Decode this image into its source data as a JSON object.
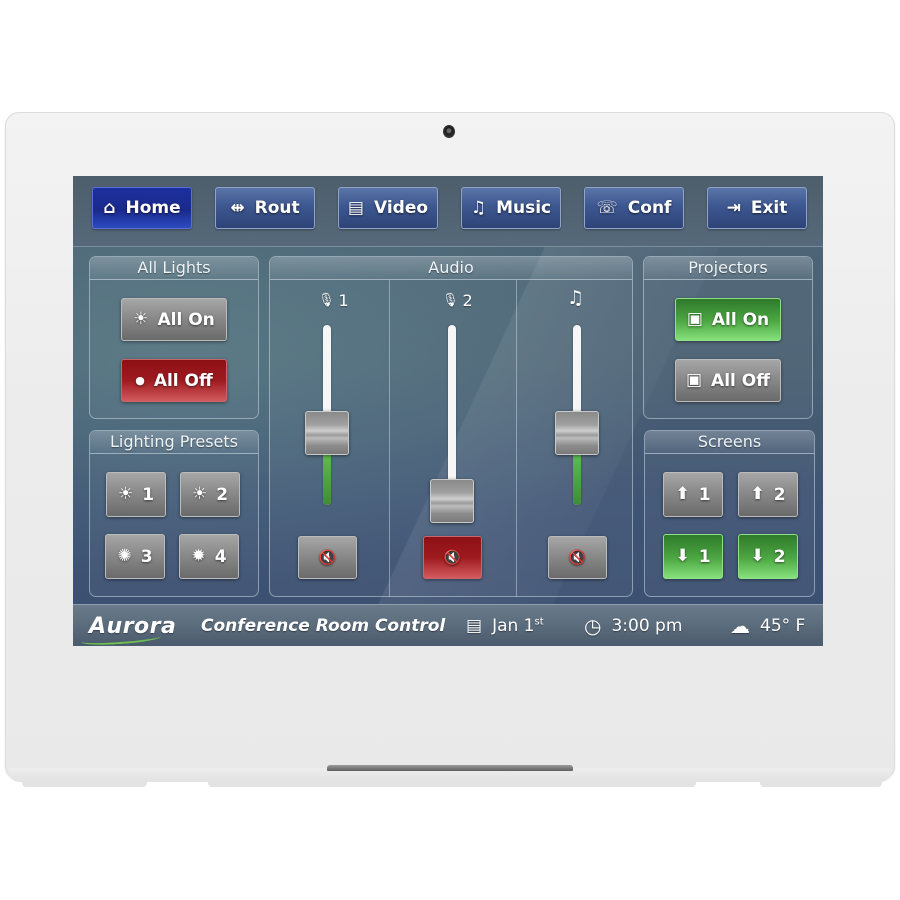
{
  "nav": {
    "items": [
      {
        "label": "Home",
        "icon": "home-icon",
        "glyph": "⌂",
        "active": true
      },
      {
        "label": "Rout",
        "icon": "route-icon",
        "glyph": "⇹",
        "active": false
      },
      {
        "label": "Video",
        "icon": "film-icon",
        "glyph": "▤",
        "active": false
      },
      {
        "label": "Music",
        "icon": "music-note-icon",
        "glyph": "♫",
        "active": false
      },
      {
        "label": "Conf",
        "icon": "conference-phone-icon",
        "glyph": "☏",
        "active": false
      },
      {
        "label": "Exit",
        "icon": "exit-icon",
        "glyph": "⇥",
        "active": false
      }
    ]
  },
  "all_lights": {
    "title": "All Lights",
    "on_label": "All On",
    "on_glyph": "☀",
    "off_label": "All Off",
    "off_glyph": "●"
  },
  "lighting_presets": {
    "title": "Lighting Presets",
    "presets": [
      {
        "label": "1",
        "glyph": "☀"
      },
      {
        "label": "2",
        "glyph": "☀"
      },
      {
        "label": "3",
        "glyph": "✺"
      },
      {
        "label": "4",
        "glyph": "✹"
      }
    ]
  },
  "audio": {
    "title": "Audio",
    "channels": [
      {
        "label": "1",
        "icon": "microphone-icon",
        "glyph": "🎙",
        "level_percent": 40,
        "muted": false
      },
      {
        "label": "2",
        "icon": "microphone-icon",
        "glyph": "🎙",
        "level_percent": 0,
        "muted": true
      },
      {
        "label": "",
        "icon": "music-note-icon",
        "glyph": "♫",
        "level_percent": 40,
        "muted": false
      }
    ],
    "mute_glyph": "🔇"
  },
  "projectors": {
    "title": "Projectors",
    "on_label": "All On",
    "off_label": "All Off",
    "glyph": "▣"
  },
  "screens": {
    "title": "Screens",
    "buttons": [
      {
        "label": "1",
        "direction": "up",
        "glyph": "⬆",
        "active": false
      },
      {
        "label": "2",
        "direction": "up",
        "glyph": "⬆",
        "active": false
      },
      {
        "label": "1",
        "direction": "down",
        "glyph": "⬇",
        "active": true
      },
      {
        "label": "2",
        "direction": "down",
        "glyph": "⬇",
        "active": true
      }
    ]
  },
  "status_bar": {
    "brand": "Aurora",
    "title": "Conference Room Control",
    "date_main": "Jan 1",
    "date_suffix": "st",
    "time": "3:00 pm",
    "weather": "45° F",
    "calendar_glyph": "▤",
    "clock_glyph": "◷",
    "weather_glyph": "☁"
  },
  "colors": {
    "active_nav": "#1c2f9e",
    "nav_button": "#3d5790",
    "off_red": "#9e1a1f",
    "on_green": "#4ea844",
    "fader_green": "#4fa745"
  }
}
